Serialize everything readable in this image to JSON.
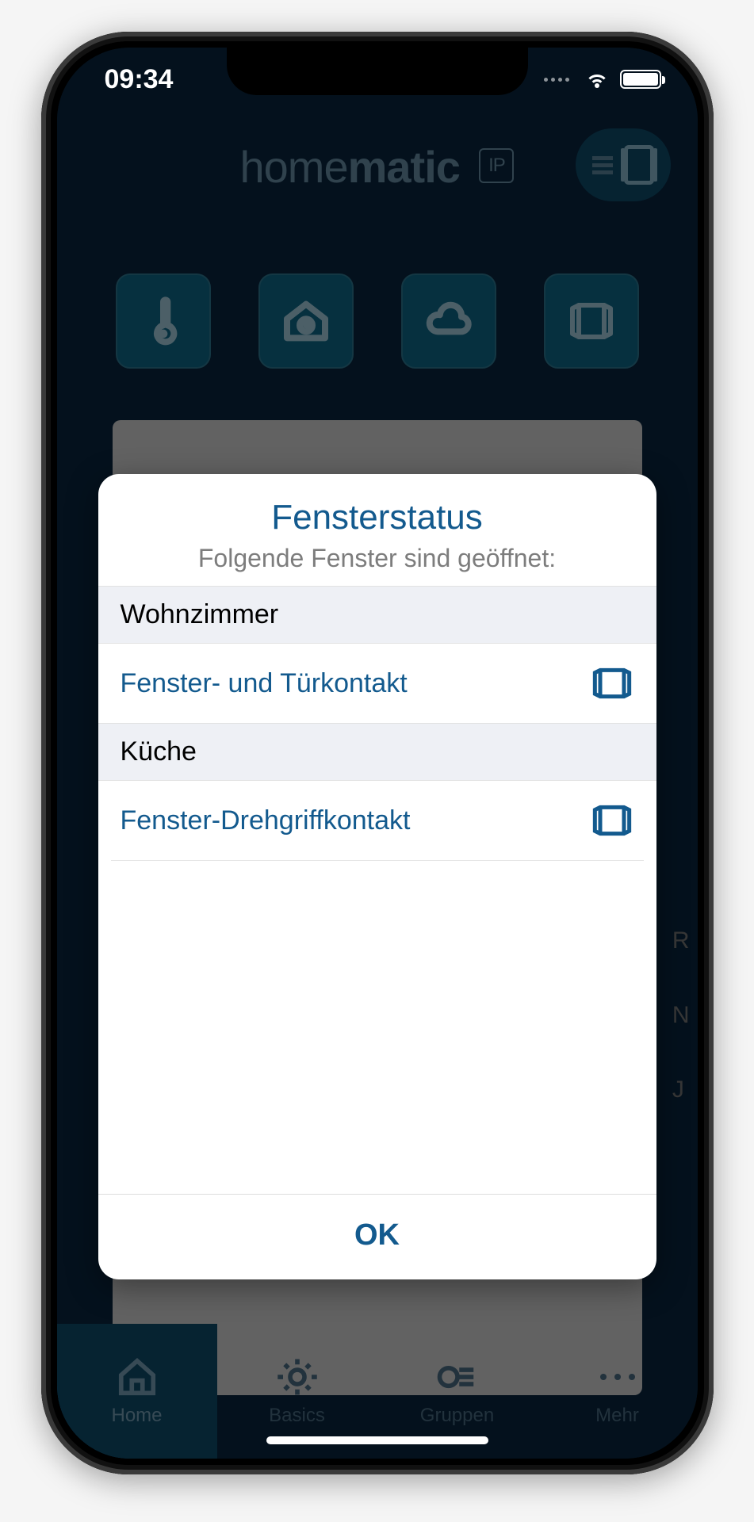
{
  "statusbar": {
    "time": "09:34"
  },
  "header": {
    "brand_prefix": "home",
    "brand_suffix": "matic",
    "brand_badge": "IP"
  },
  "dialog": {
    "title": "Fensterstatus",
    "subtitle": "Folgende Fenster sind geöffnet:",
    "sections": [
      {
        "room": "Wohnzimmer",
        "item": "Fenster- und Türkontakt"
      },
      {
        "room": "Küche",
        "item": "Fenster-Drehgriffkontakt"
      }
    ],
    "ok": "OK"
  },
  "tabs": {
    "home": "Home",
    "basics": "Basics",
    "groups": "Gruppen",
    "more": "Mehr"
  },
  "side_letters": [
    "R",
    "N",
    "J"
  ]
}
